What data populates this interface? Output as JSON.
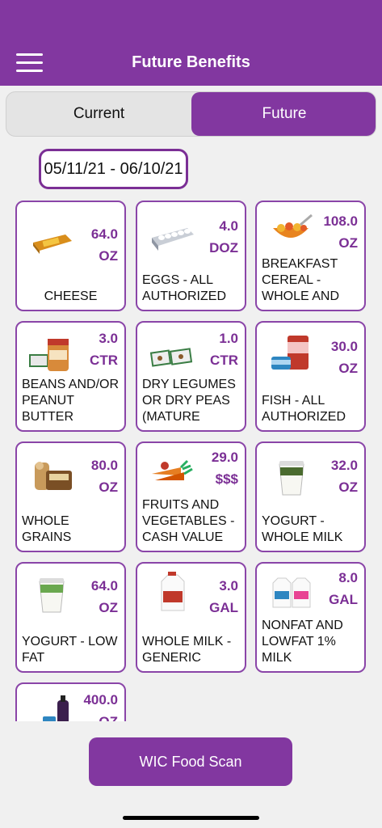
{
  "header": {
    "title": "Future Benefits"
  },
  "tabs": {
    "current": "Current",
    "future": "Future"
  },
  "date_range": "05/11/21 - 06/10/21",
  "benefits": [
    {
      "amount": "64.0",
      "unit": "OZ",
      "name": "CHEESE",
      "icon": "cheese-icon"
    },
    {
      "amount": "4.0",
      "unit": "DOZ",
      "name": "EGGS - ALL AUTHORIZED",
      "icon": "eggs-icon"
    },
    {
      "amount": "108.0",
      "unit": "OZ",
      "name": "BREAKFAST CEREAL - WHOLE AND",
      "icon": "cereal-icon"
    },
    {
      "amount": "3.0",
      "unit": "CTR",
      "name": "BEANS AND/OR PEANUT BUTTER",
      "icon": "peanut-butter-icon"
    },
    {
      "amount": "1.0",
      "unit": "CTR",
      "name": "DRY LEGUMES OR DRY PEAS (MATURE",
      "icon": "dry-legumes-icon"
    },
    {
      "amount": "30.0",
      "unit": "OZ",
      "name": "FISH - ALL AUTHORIZED",
      "icon": "fish-can-icon"
    },
    {
      "amount": "80.0",
      "unit": "OZ",
      "name": "WHOLE GRAINS",
      "icon": "bread-icon"
    },
    {
      "amount": "29.0",
      "unit": "$$$",
      "name": "FRUITS AND VEGETABLES - CASH VALUE",
      "icon": "carrots-icon"
    },
    {
      "amount": "32.0",
      "unit": "OZ",
      "name": "YOGURT - WHOLE MILK",
      "icon": "yogurt-icon"
    },
    {
      "amount": "64.0",
      "unit": "OZ",
      "name": "YOGURT - LOW FAT",
      "icon": "yogurt-icon"
    },
    {
      "amount": "3.0",
      "unit": "GAL",
      "name": "WHOLE MILK - GENERIC",
      "icon": "milk-gallon-icon"
    },
    {
      "amount": "8.0",
      "unit": "GAL",
      "name": "NONFAT AND LOWFAT 1% MILK",
      "icon": "milk-jugs-icon"
    },
    {
      "amount": "400.0",
      "unit": "OZ",
      "name": "",
      "icon": "juice-bottles-icon"
    }
  ],
  "scan_button": "WIC Food Scan",
  "colors": {
    "brand": "#8237a0",
    "accent_text": "#7b2f95"
  }
}
